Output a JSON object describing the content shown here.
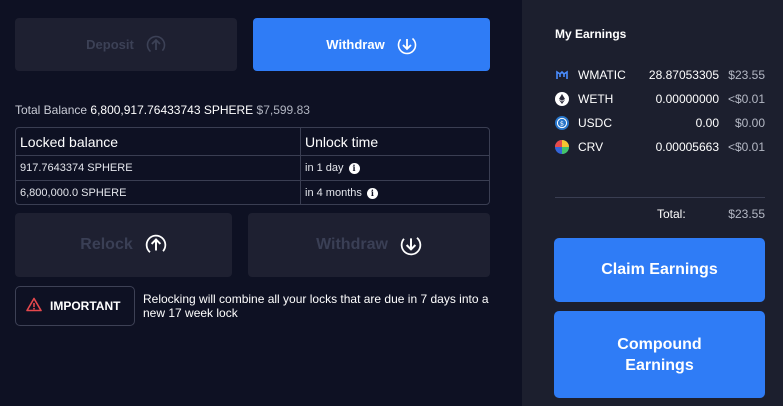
{
  "actions": {
    "deposit_label": "Deposit",
    "withdraw_label": "Withdraw"
  },
  "balance": {
    "label": "Total Balance",
    "amount": "6,800,917.76433743 SPHERE",
    "usd": "$7,599.83"
  },
  "locks_table": {
    "headers": [
      "Locked balance",
      "Unlock time"
    ],
    "rows": [
      {
        "amount": "917.7643374 SPHERE",
        "unlock": "in 1 day"
      },
      {
        "amount": "6,800,000.0 SPHERE",
        "unlock": "in 4 months"
      }
    ]
  },
  "lock_actions": {
    "relock_label": "Relock",
    "withdraw_label": "Withdraw"
  },
  "notice": {
    "badge": "IMPORTANT",
    "text": "Relocking will combine all your locks that are due in 7 days into a new 17 week lock"
  },
  "earnings": {
    "title": "My Earnings",
    "tokens": [
      {
        "symbol": "WMATIC",
        "amount": "28.87053305",
        "usd": "$23.55",
        "icon": "wmatic-icon"
      },
      {
        "symbol": "WETH",
        "amount": "0.00000000",
        "usd": "<$0.01",
        "icon": "weth-icon"
      },
      {
        "symbol": "USDC",
        "amount": "0.00",
        "usd": "$0.00",
        "icon": "usdc-icon"
      },
      {
        "symbol": "CRV",
        "amount": "0.00005663",
        "usd": "<$0.01",
        "icon": "crv-icon"
      }
    ],
    "total_label": "Total:",
    "total_value": "$23.55",
    "claim_label": "Claim Earnings",
    "compound_label": "Compound Earnings"
  },
  "colors": {
    "accent": "#2f7cf6",
    "background": "#0e1123",
    "panel": "#1c1f2e"
  }
}
